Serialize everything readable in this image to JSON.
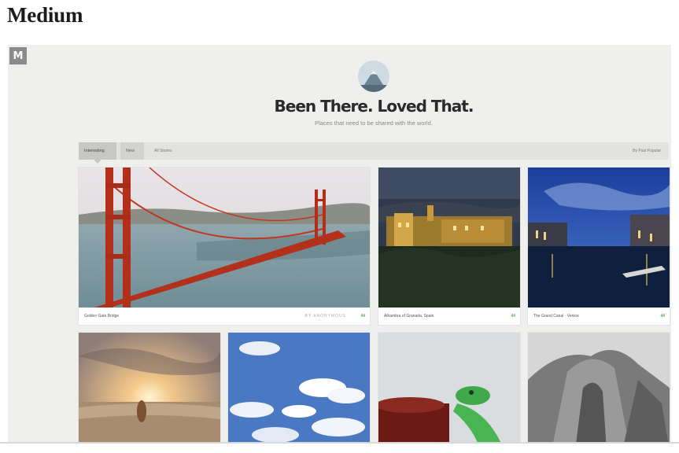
{
  "page_heading": "Medium",
  "publication": {
    "logo_glyph": "M",
    "title": "Been There. Loved That.",
    "tagline": "Places that need to be shared with the world."
  },
  "nav": {
    "tabs": [
      {
        "label": "Interesting",
        "active": true
      },
      {
        "label": "New",
        "active": false
      }
    ],
    "filter_label": "All Stories",
    "right_label": "By Past Popular"
  },
  "cards": [
    {
      "caption": "Golden Gate Bridge",
      "author": "BY ANONYMOUS",
      "stats": "44"
    },
    {
      "caption": "Alhambra of Granada, Spain",
      "stats": "44"
    },
    {
      "caption": "The Grand Canal · Venice",
      "stats": "44"
    },
    {
      "caption": ""
    },
    {
      "caption": ""
    },
    {
      "caption": ""
    },
    {
      "caption": ""
    }
  ],
  "colors": {
    "frame_background": "#efefed",
    "recommend_green": "#5aa55a",
    "bridge_red": "#c1361f"
  }
}
